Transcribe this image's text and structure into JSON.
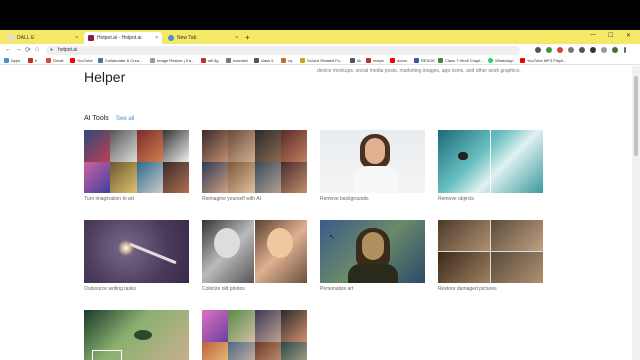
{
  "browser": {
    "tabs": [
      {
        "label": "DALL·E",
        "close": "×"
      },
      {
        "label": "Hotpot.ai - Hotpot.ai",
        "close": "×"
      },
      {
        "label": "New Tab",
        "close": "×"
      }
    ],
    "new_tab": "+",
    "window_controls": [
      "—",
      "☐",
      "✕"
    ],
    "nav": {
      "back": "←",
      "forward": "→",
      "reload": "⟳",
      "home": "⌂"
    },
    "url": "hotpot.ai",
    "bookmarks": [
      "Apps",
      "ri",
      "Gmail",
      "YouTube",
      "Collaborate & Crea...",
      "Image Resizer | Ea...",
      "sifi 5g",
      "examtrix",
      "class 5",
      "cq",
      "School Related Fo...",
      "kk",
      "recipe",
      "doom",
      "RESOE",
      "Class 7 Hindi Chapt...",
      "WhatsApp",
      "YouTube MP3 Playli..."
    ]
  },
  "page": {
    "heading": "Helper",
    "subtext": "device mockups, social media posts, marketing images, app icons, and other work graphics.",
    "section_title": "AI Tools",
    "see_all": "See all",
    "tools": [
      {
        "label": "Turn imagination to art"
      },
      {
        "label": "Reimagine yourself with AI"
      },
      {
        "label": "Remove backgrounds"
      },
      {
        "label": "Remove objects"
      },
      {
        "label": "Outsource writing tasks"
      },
      {
        "label": "Colorize old photos"
      },
      {
        "label": "Personalize art"
      },
      {
        "label": "Restore damaged pictures"
      },
      {
        "label": ""
      },
      {
        "label": ""
      }
    ]
  },
  "colors": {
    "tabstrip": "#f5e866",
    "link": "#4a8fd4"
  }
}
